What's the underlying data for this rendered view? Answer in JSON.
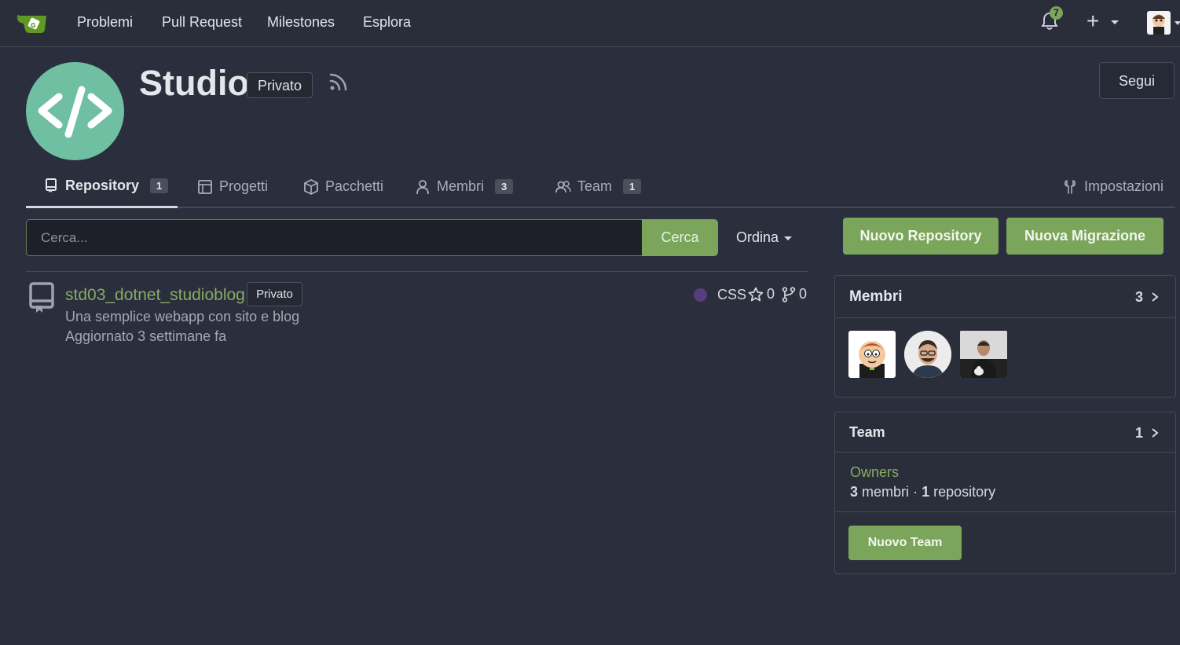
{
  "nav": {
    "links": [
      "Problemi",
      "Pull Request",
      "Milestones",
      "Esplora"
    ],
    "notification_count": "7"
  },
  "org": {
    "name": "Studio",
    "visibility": "Privato",
    "follow_label": "Segui"
  },
  "tabs": [
    {
      "label": "Repository",
      "count": "1",
      "icon": "repo-icon"
    },
    {
      "label": "Progetti",
      "icon": "project-icon"
    },
    {
      "label": "Pacchetti",
      "icon": "package-icon"
    },
    {
      "label": "Membri",
      "count": "3",
      "icon": "person-icon"
    },
    {
      "label": "Team",
      "count": "1",
      "icon": "people-icon"
    },
    {
      "label": "Impostazioni",
      "icon": "tools-icon"
    }
  ],
  "search": {
    "placeholder": "Cerca...",
    "button": "Cerca",
    "sort_label": "Ordina"
  },
  "repos": [
    {
      "name": "std03_dotnet_studioblog",
      "visibility": "Privato",
      "description": "Una semplice webapp con sito e blog",
      "updated": "Aggiornato 3 settimane fa",
      "language": "CSS",
      "language_color": "#563d7c",
      "stars": "0",
      "forks": "0"
    }
  ],
  "actions": {
    "new_repo": "Nuovo Repository",
    "new_migration": "Nuova Migrazione"
  },
  "members_card": {
    "title": "Membri",
    "count": "3"
  },
  "team_card": {
    "title": "Team",
    "count": "1",
    "team_name": "Owners",
    "members_count": "3",
    "members_label": "membri",
    "separator": "·",
    "repo_count": "1",
    "repo_label": "repository",
    "new_team": "Nuovo Team"
  },
  "colors": {
    "accent": "#7ba55a",
    "background": "#2b2f3d",
    "link": "#87ab63"
  }
}
